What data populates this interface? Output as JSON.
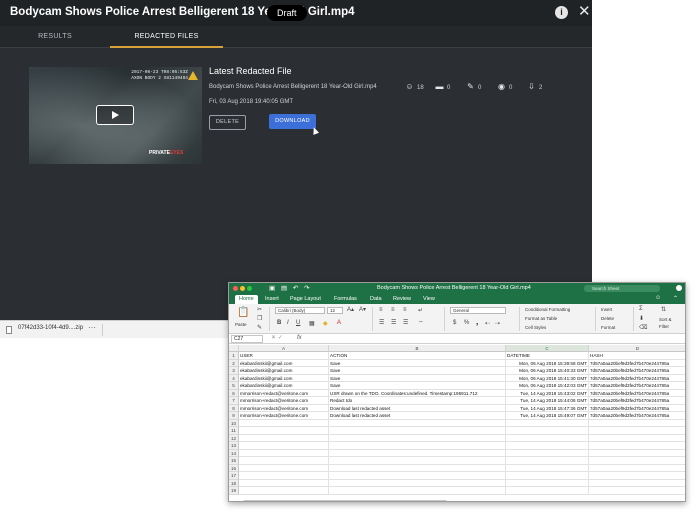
{
  "app": {
    "title": "Bodycam Shows Police Arrest Belligerent 18 Year-Old Girl.mp4",
    "badge": "Draft",
    "tabs": [
      "RESULTS",
      "REDACTED FILES"
    ],
    "active_tab": "REDACTED FILES",
    "thumbnail": {
      "stamp_line1": "2017-06-23 T08:05:53Z",
      "stamp_line2": "AXON BODY 2 X81149494",
      "watermark_prefix": "PRIVATE",
      "watermark_suffix": "EYES"
    },
    "latest": {
      "title": "Latest Redacted File",
      "filename": "Bodycam Shows Police Arrest Belligerent 18 Year-Old Girl.mp4",
      "date": "Fri, 03 Aug 2018 19:40:05 GMT"
    },
    "stats": [
      {
        "icon": "face-icon",
        "glyph": "☺",
        "value": "18"
      },
      {
        "icon": "folder-icon",
        "glyph": "▬",
        "value": "0"
      },
      {
        "icon": "pencil-icon",
        "glyph": "✎",
        "value": "0"
      },
      {
        "icon": "eye-icon",
        "glyph": "◉",
        "value": "0"
      },
      {
        "icon": "download-icon",
        "glyph": "⇩",
        "value": "2"
      }
    ],
    "buttons": {
      "delete": "DELETE",
      "download": "DOWNLOAD"
    },
    "colors": {
      "accent": "#d8a13a",
      "primary": "#3c6fd8",
      "panel": "#2b2f33"
    }
  },
  "download_bar": {
    "filename": "07f42d33-10f4-4d9....zip",
    "more": "···"
  },
  "excel": {
    "title": "Bodycam Shows Police Arrest Belligerent 18 Year-Old Girl.mp4",
    "search_placeholder": "Search Sheet",
    "ribbon_tabs": [
      "Home",
      "Insert",
      "Page Layout",
      "Formulas",
      "Data",
      "Review",
      "View"
    ],
    "active_ribbon_tab": "Home",
    "ribbon": {
      "paste": "Paste",
      "font": "Calibri (Body)",
      "size": "12",
      "number_format": "General",
      "conditional": "Conditional Formatting",
      "format_table": "Format as Table",
      "cell_styles": "Cell Styles",
      "insert": "Insert",
      "delete": "Delete",
      "format": "Format",
      "sort": "Sort &",
      "filter": "Filter"
    },
    "name_box": "C27",
    "fx": "fx",
    "columns": [
      "A",
      "B",
      "C",
      "D"
    ],
    "selected_column": "C",
    "row_numbers": [
      "1",
      "2",
      "3",
      "4",
      "5",
      "6",
      "7",
      "8",
      "9",
      "10",
      "11",
      "12",
      "13",
      "14",
      "15",
      "16",
      "17",
      "18",
      "19"
    ],
    "header_row": [
      "USER",
      "ACTION",
      "DATETIME",
      "HASH"
    ],
    "rows": [
      [
        "ekabardinskii@gmail.com",
        "Save",
        "Mon, 06 Aug 2018 15:39:58 GMT",
        "7d57a0aa20bef9d3fed7b470e244785a"
      ],
      [
        "ekabardinskii@gmail.com",
        "Save",
        "Mon, 06 Aug 2018 15:40:33 GMT",
        "7d57a0aa20bef9d3fed7b470e244785a"
      ],
      [
        "ekabardinskii@gmail.com",
        "Save",
        "Mon, 06 Aug 2018 15:41:30 GMT",
        "7d57a0aa20bef9d3fed7b470e244785a"
      ],
      [
        "ekabardinskii@gmail.com",
        "Save",
        "Mon, 06 Aug 2018 15:42:03 GMT",
        "7d57a0aa20bef9d3fed7b470e244785a"
      ],
      [
        "mmorrison+redact@veritone.com",
        "USR drawn on the TDO. Coordinates:undefined. Timestamp:195911.712",
        "Tue, 14 Aug 2018 15:43:02 GMT",
        "7d57a0aa20bef9d3fed7b470e244785a"
      ],
      [
        "mmorrison+redact@veritone.com",
        "Redact tdo",
        "Tue, 14 Aug 2018 15:44:06 GMT",
        "7d57a0aa20bef9d3fed7b470e244785a"
      ],
      [
        "mmorrison+redact@veritone.com",
        "Download last redacted asset",
        "Tue, 14 Aug 2018 15:47:36 GMT",
        "7d57a0aa20bef9d3fed7b470e244785a"
      ],
      [
        "mmorrison+redact@veritone.com",
        "Download last redacted asset",
        "Tue, 14 Aug 2018 15:49:07 GMT",
        "7d57a0aa20bef9d3fed7b470e244785a"
      ]
    ]
  }
}
